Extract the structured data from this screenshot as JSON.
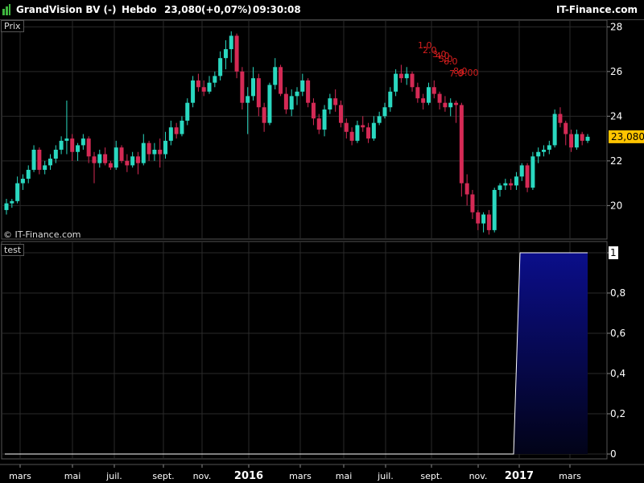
{
  "header": {
    "instrument": "GrandVision BV (-)",
    "period": "Hebdo",
    "price": "23,080",
    "change": "(+0,07%)",
    "time": "09:30:08",
    "brand": "IT-Finance.com"
  },
  "colors": {
    "up": "#2ad8c0",
    "down": "#d42a55",
    "annotation": "#d81e1e",
    "price_badge": "#ffc400",
    "area_fill": "#0b0e8a"
  },
  "chart_data": [
    {
      "type": "candlestick",
      "panel_label": "Prix",
      "watermark": "© IT-Finance.com",
      "last_price_label": "23,080",
      "last_price": 23.08,
      "ylim": [
        18.5,
        28.3
      ],
      "y_ticks": [
        20,
        22,
        24,
        26,
        28
      ],
      "x_ticks": [
        "mars",
        "mai",
        "juil.",
        "sept.",
        "nov.",
        "2016",
        "mars",
        "mai",
        "juil.",
        "sept.",
        "nov.",
        "2017",
        "mars"
      ],
      "bold_x_ticks": [
        "2016",
        "2017"
      ],
      "candles": [
        [
          19.8,
          20.3,
          19.6,
          20.1
        ],
        [
          20.1,
          20.3,
          19.9,
          20.2
        ],
        [
          20.2,
          21.3,
          20.1,
          21.0
        ],
        [
          21.0,
          21.4,
          20.7,
          21.2
        ],
        [
          21.2,
          21.8,
          21.0,
          21.6
        ],
        [
          21.6,
          22.7,
          21.5,
          22.5
        ],
        [
          22.5,
          22.6,
          21.4,
          21.6
        ],
        [
          21.6,
          22.0,
          21.4,
          21.8
        ],
        [
          21.8,
          22.3,
          21.6,
          22.1
        ],
        [
          22.1,
          22.7,
          21.9,
          22.5
        ],
        [
          22.5,
          23.1,
          22.3,
          22.9
        ],
        [
          22.9,
          24.7,
          22.3,
          23.0
        ],
        [
          23.0,
          23.2,
          22.0,
          22.4
        ],
        [
          22.4,
          22.8,
          22.0,
          22.7
        ],
        [
          22.7,
          23.2,
          22.5,
          23.0
        ],
        [
          23.0,
          23.1,
          21.9,
          22.2
        ],
        [
          22.2,
          22.4,
          21.0,
          21.9
        ],
        [
          21.9,
          22.5,
          21.7,
          22.3
        ],
        [
          22.3,
          22.6,
          21.8,
          21.9
        ],
        [
          21.9,
          22.0,
          21.6,
          21.7
        ],
        [
          21.7,
          22.9,
          21.6,
          22.6
        ],
        [
          22.6,
          22.7,
          21.9,
          22.0
        ],
        [
          22.0,
          22.3,
          21.5,
          21.8
        ],
        [
          21.8,
          22.4,
          21.7,
          22.2
        ],
        [
          22.2,
          22.4,
          21.4,
          21.9
        ],
        [
          21.9,
          23.2,
          21.8,
          22.8
        ],
        [
          22.8,
          22.9,
          22.0,
          22.3
        ],
        [
          22.3,
          22.8,
          22.0,
          22.5
        ],
        [
          22.5,
          23.0,
          21.7,
          22.3
        ],
        [
          22.3,
          23.3,
          22.1,
          22.9
        ],
        [
          22.9,
          23.8,
          22.7,
          23.5
        ],
        [
          23.5,
          23.7,
          23.0,
          23.2
        ],
        [
          23.2,
          24.0,
          23.1,
          23.8
        ],
        [
          23.8,
          24.8,
          23.6,
          24.6
        ],
        [
          24.6,
          25.8,
          24.4,
          25.6
        ],
        [
          25.6,
          25.9,
          25.1,
          25.3
        ],
        [
          25.3,
          25.6,
          24.9,
          25.1
        ],
        [
          25.1,
          25.8,
          25.0,
          25.5
        ],
        [
          25.5,
          26.0,
          25.3,
          25.8
        ],
        [
          25.8,
          26.9,
          25.6,
          26.6
        ],
        [
          26.6,
          27.4,
          26.1,
          27.0
        ],
        [
          27.0,
          27.8,
          26.4,
          27.6
        ],
        [
          27.6,
          27.7,
          25.7,
          26.0
        ],
        [
          26.0,
          26.2,
          24.3,
          24.6
        ],
        [
          24.6,
          25.3,
          23.2,
          24.9
        ],
        [
          24.9,
          26.2,
          24.7,
          25.7
        ],
        [
          25.7,
          25.9,
          24.0,
          24.4
        ],
        [
          24.4,
          24.6,
          23.3,
          23.7
        ],
        [
          23.7,
          25.5,
          23.6,
          25.4
        ],
        [
          25.4,
          26.6,
          25.2,
          26.2
        ],
        [
          26.2,
          26.3,
          24.9,
          25.0
        ],
        [
          25.0,
          25.3,
          24.1,
          24.3
        ],
        [
          24.3,
          25.2,
          24.0,
          24.9
        ],
        [
          24.9,
          25.3,
          24.5,
          25.1
        ],
        [
          25.1,
          25.9,
          24.9,
          25.6
        ],
        [
          25.6,
          25.7,
          24.4,
          24.6
        ],
        [
          24.6,
          24.8,
          23.6,
          23.9
        ],
        [
          23.9,
          24.1,
          23.2,
          23.4
        ],
        [
          23.4,
          24.5,
          23.1,
          24.3
        ],
        [
          24.3,
          25.0,
          24.1,
          24.8
        ],
        [
          24.8,
          25.2,
          24.2,
          24.5
        ],
        [
          24.5,
          24.7,
          23.5,
          23.7
        ],
        [
          23.7,
          23.9,
          23.0,
          23.3
        ],
        [
          23.3,
          23.5,
          22.7,
          22.9
        ],
        [
          22.9,
          23.8,
          22.8,
          23.6
        ],
        [
          23.6,
          24.0,
          23.3,
          23.5
        ],
        [
          23.5,
          23.7,
          22.8,
          23.0
        ],
        [
          23.0,
          24.0,
          22.9,
          23.7
        ],
        [
          23.7,
          24.2,
          23.6,
          24.0
        ],
        [
          24.0,
          24.6,
          23.9,
          24.4
        ],
        [
          24.4,
          25.3,
          24.2,
          25.1
        ],
        [
          25.1,
          26.1,
          24.9,
          25.9
        ],
        [
          25.9,
          26.3,
          25.5,
          25.7
        ],
        [
          25.7,
          26.2,
          25.4,
          25.9
        ],
        [
          25.9,
          26.0,
          25.1,
          25.3
        ],
        [
          25.3,
          25.5,
          24.6,
          24.8
        ],
        [
          24.8,
          25.0,
          24.3,
          24.6
        ],
        [
          24.6,
          25.5,
          24.5,
          25.3
        ],
        [
          25.3,
          25.6,
          24.8,
          25.0
        ],
        [
          25.0,
          25.1,
          24.3,
          24.6
        ],
        [
          24.6,
          24.9,
          24.2,
          24.4
        ],
        [
          24.4,
          24.8,
          24.0,
          24.6
        ],
        [
          24.6,
          24.7,
          23.7,
          24.5
        ],
        [
          24.5,
          24.6,
          20.4,
          21.0
        ],
        [
          21.0,
          21.4,
          20.0,
          20.5
        ],
        [
          20.5,
          20.7,
          19.4,
          19.7
        ],
        [
          19.7,
          19.8,
          18.9,
          19.2
        ],
        [
          19.2,
          19.7,
          18.8,
          19.6
        ],
        [
          19.6,
          19.8,
          18.7,
          18.9
        ],
        [
          18.9,
          20.8,
          18.8,
          20.7
        ],
        [
          20.7,
          21.0,
          20.4,
          20.9
        ],
        [
          20.9,
          21.2,
          20.7,
          21.0
        ],
        [
          21.0,
          21.2,
          20.7,
          20.9
        ],
        [
          20.9,
          21.5,
          20.7,
          21.3
        ],
        [
          21.3,
          21.9,
          21.1,
          21.8
        ],
        [
          21.8,
          21.9,
          20.6,
          20.8
        ],
        [
          20.8,
          22.4,
          20.7,
          22.2
        ],
        [
          22.2,
          22.6,
          21.9,
          22.4
        ],
        [
          22.4,
          22.7,
          22.2,
          22.5
        ],
        [
          22.5,
          22.9,
          22.3,
          22.7
        ],
        [
          22.7,
          24.3,
          22.6,
          24.1
        ],
        [
          24.1,
          24.4,
          23.5,
          23.7
        ],
        [
          23.7,
          23.8,
          22.7,
          23.2
        ],
        [
          23.2,
          23.4,
          22.4,
          22.6
        ],
        [
          22.6,
          23.4,
          22.5,
          23.2
        ],
        [
          23.2,
          23.3,
          22.7,
          22.9
        ],
        [
          22.9,
          23.2,
          22.8,
          23.08
        ]
      ],
      "annotations": [
        "1.0",
        "2.0",
        "3.0",
        "4.0",
        "5.0",
        "6.0",
        "7.0",
        "8.0",
        "9.00"
      ]
    },
    {
      "type": "area",
      "panel_label": "test",
      "ylim": [
        0,
        1
      ],
      "y_ticks": [
        "0",
        "0,2",
        "0,4",
        "0,6",
        "0,8",
        "1"
      ],
      "x": [
        "2015-03",
        "2016-12",
        "2017-01",
        "2017-04"
      ],
      "values": [
        0,
        0,
        1,
        1
      ]
    }
  ]
}
